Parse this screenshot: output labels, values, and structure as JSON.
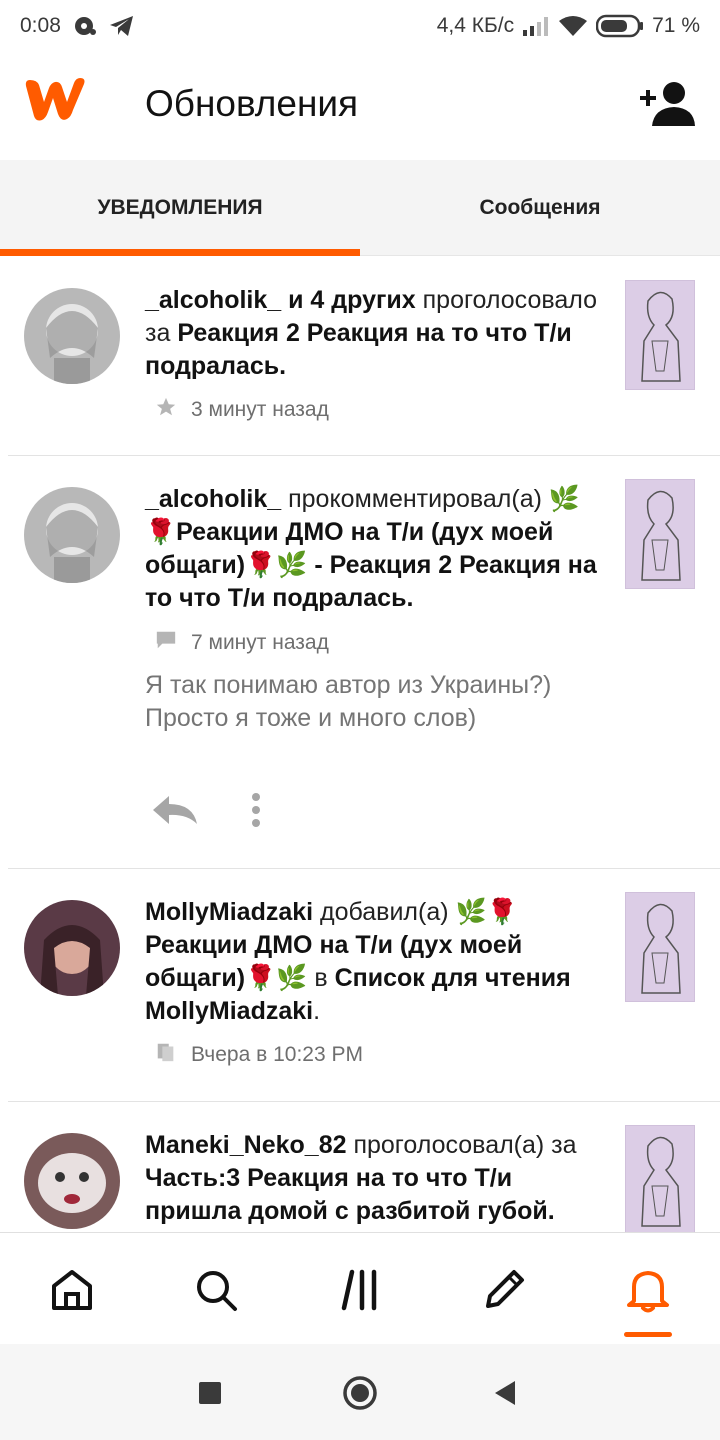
{
  "status_bar": {
    "time": "0:08",
    "network_speed": "4,4 КБ/с",
    "battery": "71 %",
    "icons": [
      "sync-icon",
      "telegram-icon",
      "signal-icon",
      "wifi-icon",
      "battery-icon"
    ]
  },
  "header": {
    "title": "Обновления",
    "logo": "wattpad-logo",
    "add_friend_icon": "add-person-icon"
  },
  "tabs": [
    {
      "label": "УВЕДОМЛЕНИЯ",
      "active": true
    },
    {
      "label": "Сообщения",
      "active": false
    }
  ],
  "notifications": [
    {
      "user": "_alcoholik_",
      "user_suffix": " и 4 других",
      "action": "проголосовало за ",
      "target": "Реакция 2 Реакция на то что Т/и подралась.",
      "time": "3 минут назад",
      "meta_icon": "star-icon"
    },
    {
      "user": "_alcoholik_",
      "action": " прокомментировал(а) ",
      "target": "🌿🌹Реакции ДМО на Т/и (дух моей общаги)🌹🌿 - Реакция 2 Реакция на то что Т/и подралась.",
      "time": "7 минут назад",
      "meta_icon": "comment-icon",
      "comment": "Я так понимаю автор из Украины?) Просто я тоже и много слов)",
      "actions": [
        "reply-icon",
        "more-vertical-icon"
      ]
    },
    {
      "user": "MollyMiadzaki",
      "action": " добавил(а) ",
      "target": "🌿🌹Реакции ДМО на Т/и (дух моей общаги)🌹🌿",
      "connector": " в ",
      "list_name": "Список для чтения MollyMiadzaki",
      "end": ".",
      "time": "Вчера в 10:23 PM",
      "meta_icon": "library-icon"
    },
    {
      "user": "Maneki_Neko_82",
      "action": " проголосовал(а) за ",
      "target": "Часть:3 Реакция на то что Т/и пришла домой с разбитой губой.",
      "meta_icon": "star-icon"
    }
  ],
  "bottom_nav": [
    {
      "name": "home-icon"
    },
    {
      "name": "search-icon"
    },
    {
      "name": "library-icon"
    },
    {
      "name": "write-icon"
    },
    {
      "name": "notifications-icon",
      "active": true
    }
  ],
  "colors": {
    "accent": "#ff5b00",
    "tab_background": "#f4f4f4",
    "thumb_background": "#dccde6",
    "muted_text": "#757575"
  }
}
